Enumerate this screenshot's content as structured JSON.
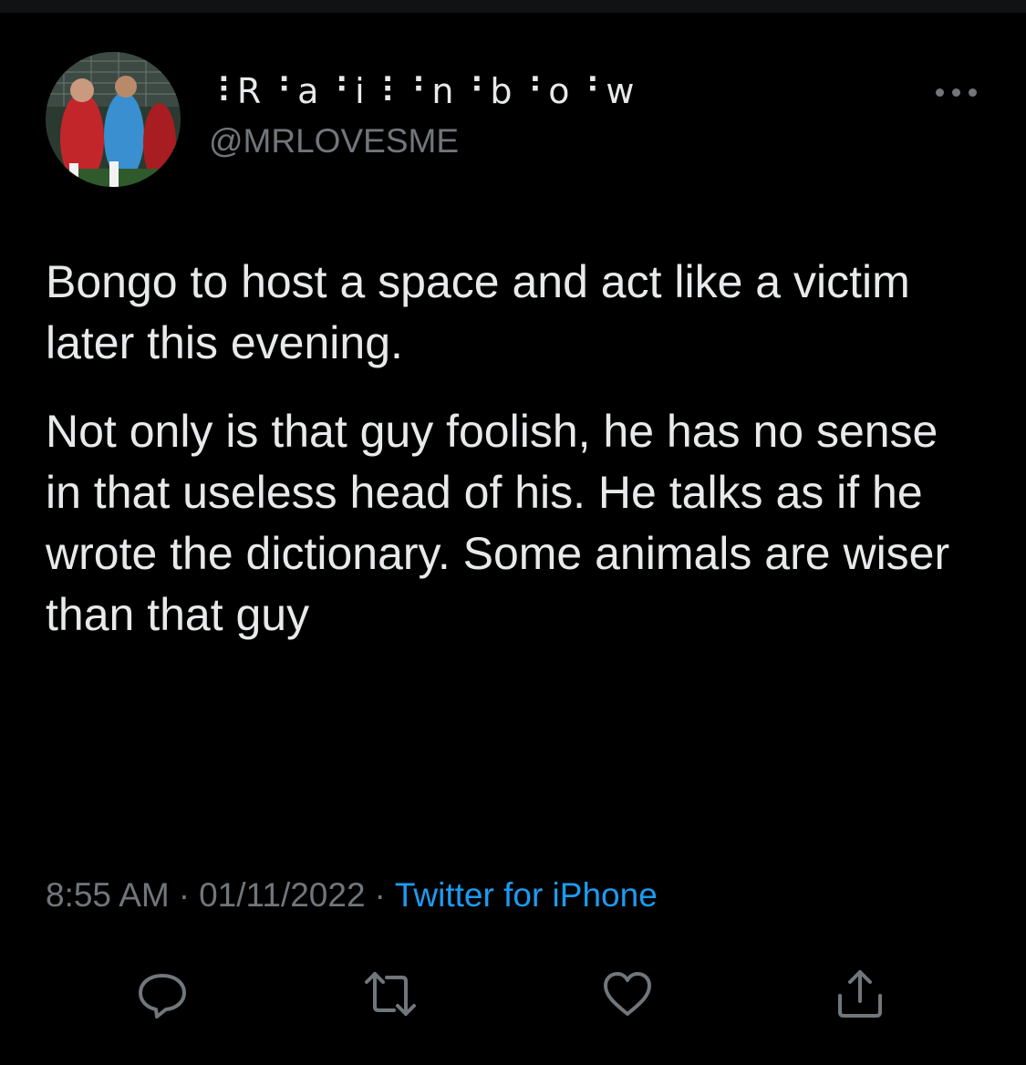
{
  "tweet": {
    "display_name": "꧁Rainbow꧂",
    "display_name_styled": "⠸R⠘a⠘i⠸⠘n⠘b⠘o⠘w",
    "handle": "@MRLOVESME",
    "paragraphs": [
      "Bongo to host a space and act like a victim later this evening.",
      "Not only is that guy foolish, he has no sense in that useless head of his. He talks as if he wrote the dictionary. Some animals are wiser than that guy"
    ],
    "time": "8:55 AM",
    "date": "01/11/2022",
    "separator": "·",
    "source": "Twitter for iPhone"
  },
  "icons": {
    "more": "more-horizontal-icon",
    "reply": "reply-icon",
    "retweet": "retweet-icon",
    "like": "heart-icon",
    "share": "share-icon"
  },
  "colors": {
    "background": "#000000",
    "text_primary": "#e7e9ea",
    "text_secondary": "#71767b",
    "accent": "#1d9bf0"
  }
}
